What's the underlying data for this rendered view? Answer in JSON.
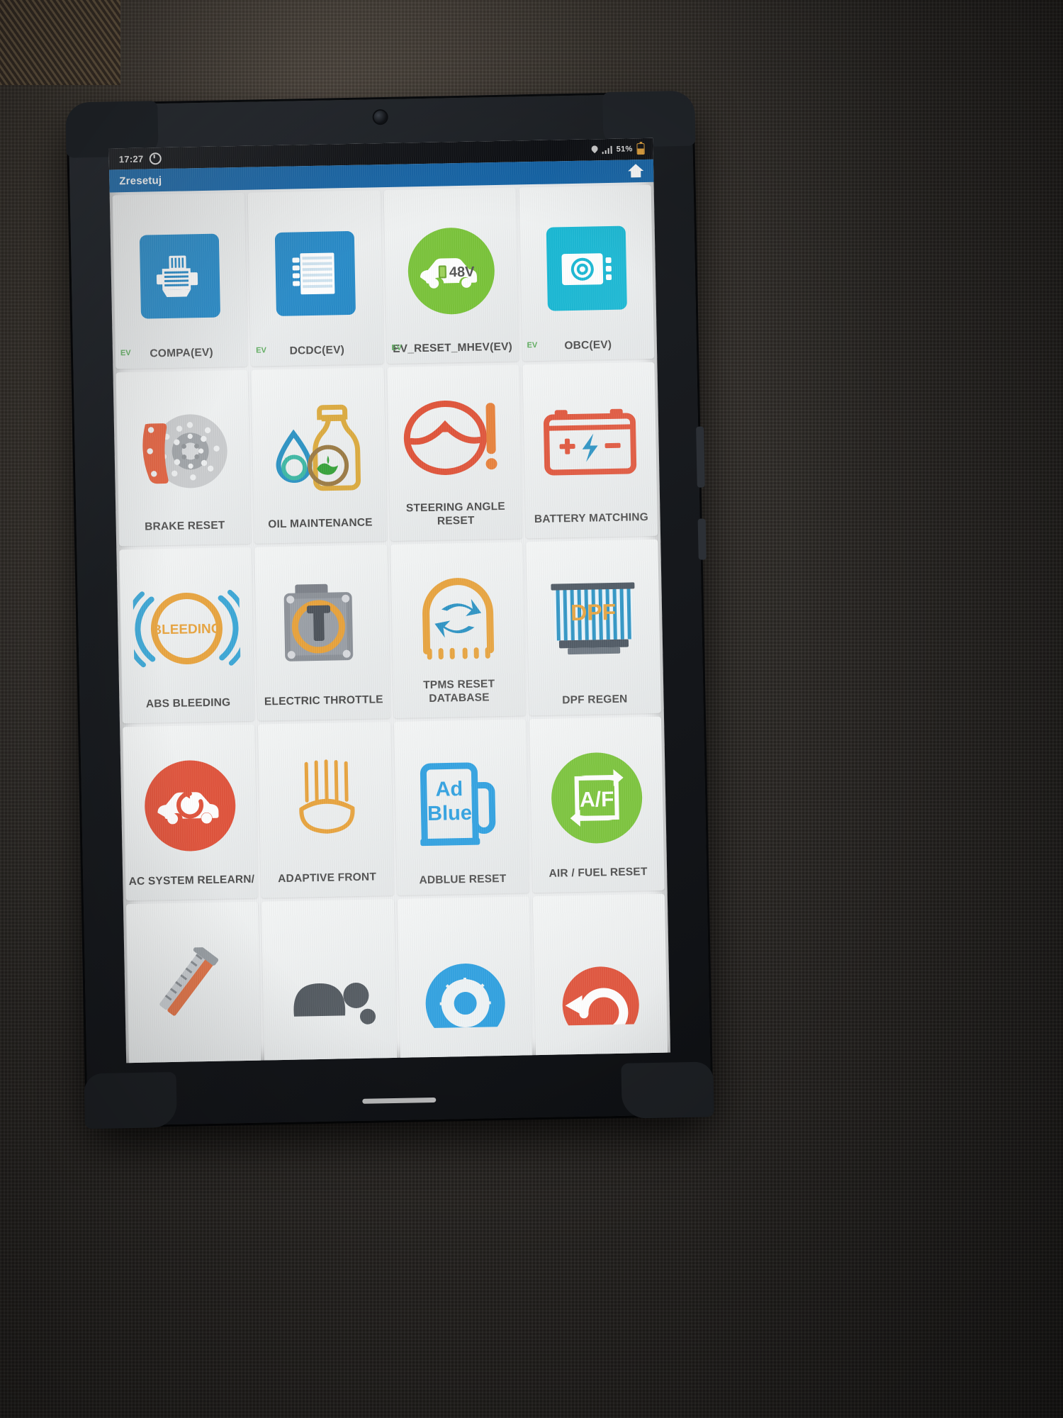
{
  "device": {
    "status_bar": {
      "time": "17:27",
      "battery_percent": "51%",
      "icons": [
        "alarm-clock-icon",
        "location-pin-icon",
        "signal-bars-icon",
        "battery-icon"
      ]
    },
    "title_bar": {
      "title": "Zresetuj",
      "home_icon": "home-icon"
    }
  },
  "grid": {
    "rows": 5,
    "columns": 4,
    "tiles": [
      {
        "label": "COMPA(EV)",
        "badge": "EV",
        "icon": "compressor-icon",
        "icon_style": "blue-square"
      },
      {
        "label": "DCDC(EV)",
        "badge": "EV",
        "icon": "dcdc-converter-icon",
        "icon_style": "blue-square"
      },
      {
        "label": "EV_RESET_MHEV(EV)",
        "badge": "EV",
        "icon": "car-48v-icon",
        "icon_style": "green-circle",
        "icon_text": "48V"
      },
      {
        "label": "OBC(EV)",
        "badge": "EV",
        "icon": "onboard-charger-icon",
        "icon_style": "teal-square"
      },
      {
        "label": "BRAKE RESET",
        "badge": "",
        "icon": "brake-disc-icon",
        "icon_style": "flat"
      },
      {
        "label": "OIL MAINTENANCE",
        "badge": "",
        "icon": "oil-bottle-icon",
        "icon_style": "flat"
      },
      {
        "label": "STEERING ANGLE RESET",
        "badge": "",
        "icon": "steering-wheel-icon",
        "icon_style": "flat"
      },
      {
        "label": "BATTERY MATCHING",
        "badge": "",
        "icon": "car-battery-icon",
        "icon_style": "flat"
      },
      {
        "label": "ABS BLEEDING",
        "badge": "",
        "icon": "abs-bleeding-icon",
        "icon_style": "flat",
        "icon_text": "BLEEDING"
      },
      {
        "label": "ELECTRIC THROTTLE",
        "badge": "",
        "icon": "throttle-body-icon",
        "icon_style": "flat"
      },
      {
        "label": "TPMS RESET DATABASE",
        "badge": "",
        "icon": "tpms-tire-icon",
        "icon_style": "flat"
      },
      {
        "label": "DPF REGEN",
        "badge": "",
        "icon": "dpf-filter-icon",
        "icon_style": "flat",
        "icon_text": "DPF"
      },
      {
        "label": "AC SYSTEM RELEARN/",
        "badge": "",
        "icon": "ac-car-reset-icon",
        "icon_style": "red-circle"
      },
      {
        "label": "ADAPTIVE FRONT",
        "badge": "",
        "icon": "headlight-beam-icon",
        "icon_style": "flat"
      },
      {
        "label": "ADBLUE RESET",
        "badge": "",
        "icon": "adblue-pump-icon",
        "icon_style": "flat",
        "icon_text": "Ad Blue"
      },
      {
        "label": "AIR / FUEL RESET",
        "badge": "",
        "icon": "air-fuel-icon",
        "icon_style": "green-circle",
        "icon_text": "A/F"
      },
      {
        "label": "",
        "badge": "",
        "icon": "caliper-gauge-icon",
        "icon_style": "flat"
      },
      {
        "label": "",
        "badge": "",
        "icon": "particles-icon",
        "icon_style": "flat"
      },
      {
        "label": "",
        "badge": "",
        "icon": "blue-fan-icon",
        "icon_style": "flat"
      },
      {
        "label": "",
        "badge": "",
        "icon": "red-reset-arrow-icon",
        "icon_style": "red-circle"
      }
    ]
  },
  "colors": {
    "title_bar": "#1565a8",
    "status_bar": "#0d0f13",
    "tile_bg": "#eff1f2",
    "label_text": "#4d4d4d",
    "ev_badge": "#5cab5c",
    "accent_blue": "#2489c8",
    "accent_teal": "#18b8d4",
    "accent_green": "#7ac43a",
    "accent_red": "#e0543c",
    "accent_orange": "#e8a33d"
  }
}
